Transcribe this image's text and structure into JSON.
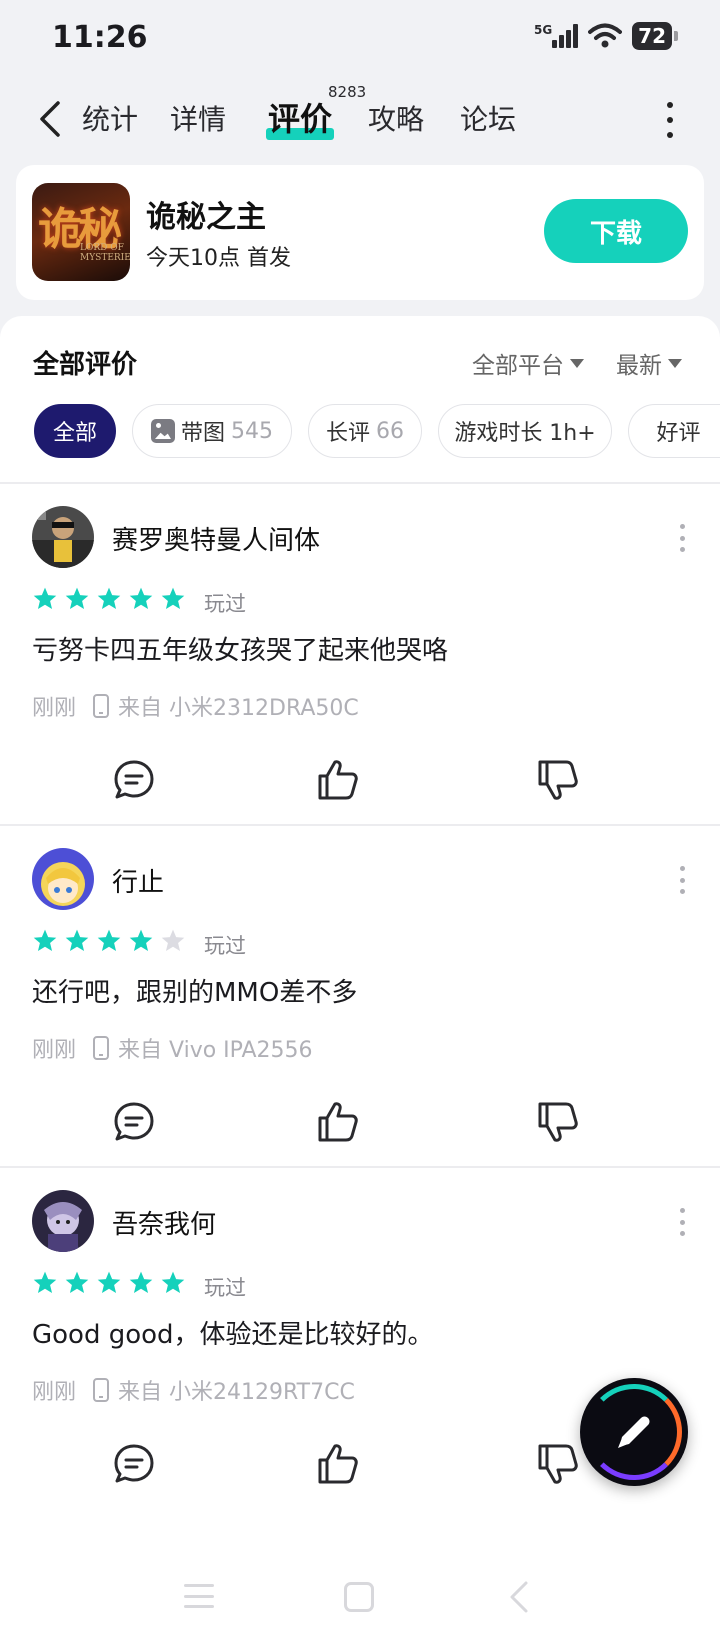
{
  "status_bar": {
    "time": "11:26",
    "network": "5G",
    "battery": "72"
  },
  "tabs": [
    {
      "label": "统计"
    },
    {
      "label": "详情"
    },
    {
      "label": "评价",
      "badge": "8283",
      "active": true
    },
    {
      "label": "攻略"
    },
    {
      "label": "论坛"
    }
  ],
  "game": {
    "name": "诡秘之主",
    "subtitle": "今天10点 首发",
    "icon_text": "诡秘",
    "icon_subtext": "LORD OF MYSTERIES",
    "download_label": "下载"
  },
  "reviews_section": {
    "title": "全部评价",
    "platform_filter": "全部平台",
    "sort_filter": "最新"
  },
  "chips": [
    {
      "label": "全部",
      "count": "",
      "active": true
    },
    {
      "label": "带图",
      "count": "545",
      "icon": "image-icon"
    },
    {
      "label": "长评",
      "count": "66"
    },
    {
      "label": "游戏时长 1h+",
      "count": ""
    },
    {
      "label": "好评",
      "count": ""
    }
  ],
  "reviews": [
    {
      "user": "赛罗奥特曼人间体",
      "rating": 5,
      "played_label": "玩过",
      "text": "亏努卡四五年级女孩哭了起来他哭咯",
      "time": "刚刚",
      "device": "来自 小米2312DRA50C"
    },
    {
      "user": "行止",
      "rating": 4,
      "played_label": "玩过",
      "text": "还行吧，跟别的MMO差不多",
      "time": "刚刚",
      "device": "来自 Vivo IPA2556"
    },
    {
      "user": "吾奈我何",
      "rating": 5,
      "played_label": "玩过",
      "text": "Good good，体验还是比较好的。",
      "time": "刚刚",
      "device": "来自 小米24129RT7CC"
    }
  ],
  "colors": {
    "accent": "#15d1bb",
    "chip_active": "#1e1a6e",
    "star_empty": "#dcdce2",
    "muted_text": "#b0b0b6"
  }
}
